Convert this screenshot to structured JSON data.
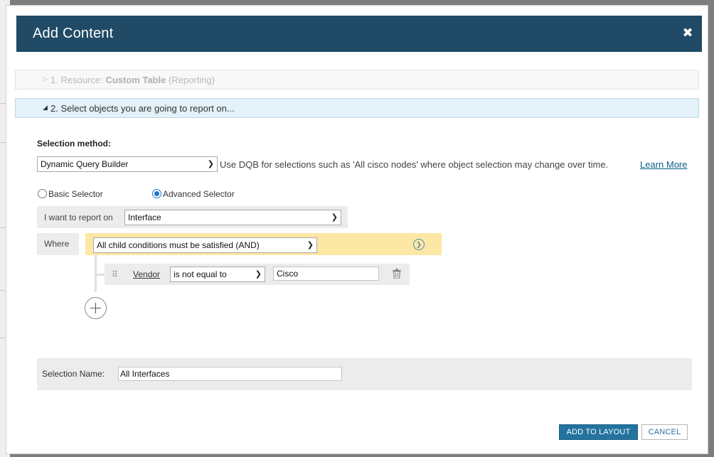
{
  "dialog": {
    "title": "Add Content",
    "close_glyph": "✖",
    "close_icon": "close-icon"
  },
  "steps": [
    {
      "number": "1.",
      "resource_label": "Resource:",
      "resource_value": "Custom Table",
      "resource_context": "(Reporting)",
      "icon": "triangle-right-icon",
      "expanded": false
    },
    {
      "label": "2. Select objects you are going to report on...",
      "icon": "triangle-down-icon",
      "expanded": true
    }
  ],
  "selection_method": {
    "label": "Selection method:",
    "value": "Dynamic Query Builder",
    "hint": "Use DQB for selections such as 'All cisco nodes' where object selection may change over time.",
    "learn_more": "Learn More"
  },
  "selector_mode": {
    "options": [
      {
        "label": "Basic Selector",
        "checked": false
      },
      {
        "label": "Advanced Selector",
        "checked": true
      }
    ]
  },
  "report_on": {
    "label": "I want to report on",
    "value": "Interface"
  },
  "where": {
    "label": "Where",
    "condition_mode": "All child conditions must be satisfied (AND)",
    "accent_color": "#fde7a5",
    "rules": [
      {
        "field": "Vendor",
        "operator": "is not equal to",
        "value": "Cisco"
      }
    ]
  },
  "selection_name": {
    "label": "Selection Name:",
    "value": "All Interfaces"
  },
  "buttons": {
    "add_to_layout": "ADD TO LAYOUT",
    "cancel": "CANCEL"
  },
  "colors": {
    "titlebar": "#204a66",
    "primary_button": "#23739e",
    "active_step": "#e3f1f8"
  }
}
